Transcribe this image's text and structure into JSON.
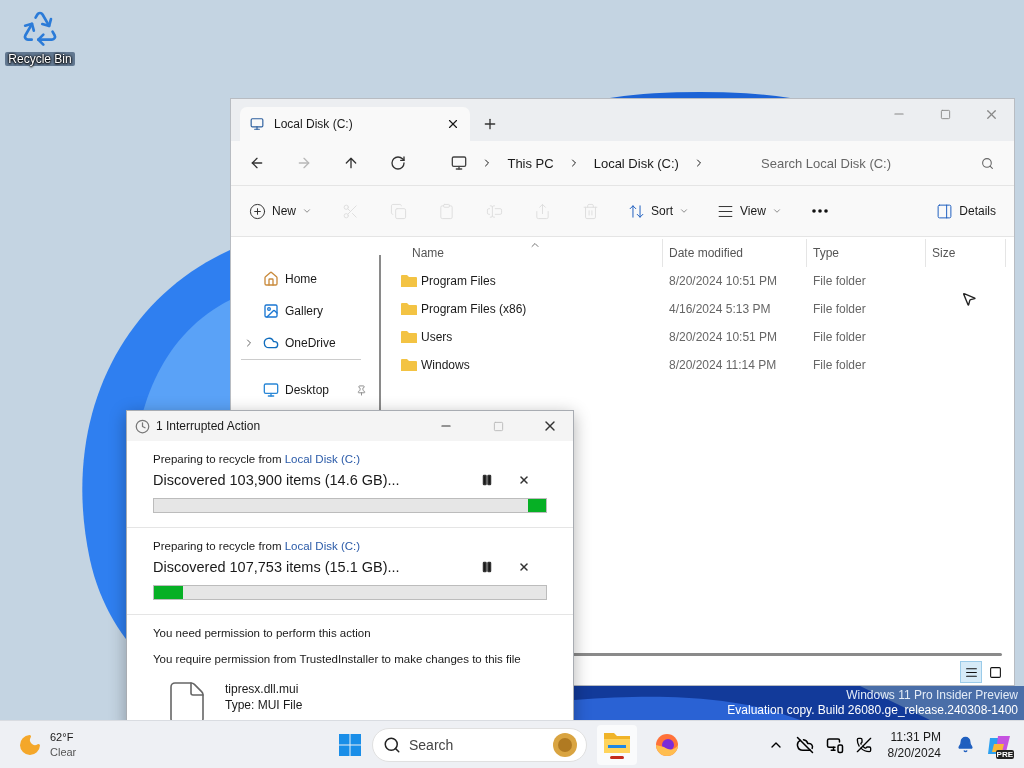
{
  "desktop_icons": [
    {
      "label": "Recycle Bin"
    }
  ],
  "explorer": {
    "tabs": [
      {
        "label": "Local Disk (C:)",
        "selected": true
      }
    ],
    "nav": [
      {
        "kind": "back",
        "disabled": false
      },
      {
        "kind": "forward",
        "disabled": true
      },
      {
        "kind": "up",
        "disabled": false
      },
      {
        "kind": "refresh",
        "disabled": false
      }
    ],
    "breadcrumb": [
      "This PC",
      "Local Disk (C:)"
    ],
    "search": {
      "placeholder": "Search Local Disk (C:)"
    },
    "toolbar": [
      {
        "kind": "new",
        "label": "New",
        "dropdown": true,
        "disabled": false
      },
      {
        "kind": "cut",
        "disabled": true
      },
      {
        "kind": "copy",
        "disabled": true
      },
      {
        "kind": "paste",
        "disabled": true
      },
      {
        "kind": "rename",
        "disabled": true
      },
      {
        "kind": "share",
        "disabled": true
      },
      {
        "kind": "delete",
        "disabled": true
      },
      {
        "kind": "sort",
        "label": "Sort",
        "dropdown": true,
        "disabled": false
      },
      {
        "kind": "view",
        "label": "View",
        "dropdown": true,
        "disabled": false
      },
      {
        "kind": "more",
        "disabled": false
      },
      {
        "kind": "details",
        "label": "Details",
        "dropdown": false,
        "disabled": false
      }
    ],
    "sidebar": {
      "items": [
        {
          "kind": "home",
          "label": "Home",
          "expandable": false,
          "pinned": false
        },
        {
          "kind": "gallery",
          "label": "Gallery",
          "expandable": false,
          "pinned": false
        },
        {
          "kind": "cloud",
          "label": "OneDrive",
          "expandable": true,
          "pinned": false
        },
        {
          "kind": "desktop",
          "label": "Desktop",
          "expandable": false,
          "pinned": true
        }
      ]
    },
    "table": {
      "columns": [
        {
          "label": "Name",
          "sorted": true
        },
        {
          "label": "Date modified",
          "sorted": false
        },
        {
          "label": "Type",
          "sorted": false
        },
        {
          "label": "Size",
          "sorted": false
        }
      ],
      "rows": [
        {
          "name": "Program Files",
          "date": "8/20/2024 10:51 PM",
          "type": "File folder"
        },
        {
          "name": "Program Files (x86)",
          "date": "4/16/2024 5:13 PM",
          "type": "File folder"
        },
        {
          "name": "Users",
          "date": "8/20/2024 10:51 PM",
          "type": "File folder"
        },
        {
          "name": "Windows",
          "date": "8/20/2024 11:14 PM",
          "type": "File folder"
        }
      ]
    },
    "view_toggles": [
      {
        "kind": "details",
        "selected": true
      },
      {
        "kind": "tiles",
        "selected": false
      }
    ]
  },
  "dialog": {
    "title": "1 Interrupted Action",
    "operations": [
      {
        "prefix": "Preparing to recycle from",
        "link": "Local Disk (C:)",
        "status": "Discovered 103,900 items (14.6 GB)...",
        "progress": {
          "kind": "trailing",
          "level": 0.046
        }
      },
      {
        "prefix": "Preparing to recycle from",
        "link": "Local Disk (C:)",
        "status": "Discovered 107,753 items (15.1 GB)...",
        "progress": {
          "kind": "leading",
          "level": 0.075
        }
      }
    ],
    "permission": {
      "heading": "You need permission to perform this action",
      "detail": "You require permission from TrustedInstaller to make changes to this file",
      "file": {
        "name": "tipresx.dll.mui",
        "type": "Type: MUI File"
      }
    }
  },
  "watermark": [
    "Windows 11 Pro Insider Preview",
    "Evaluation copy. Build 26080.ge_release.240308-1400"
  ],
  "taskbar": {
    "weather": {
      "temperature": "62°F",
      "condition": "Clear"
    },
    "search": {
      "placeholder": "Search"
    },
    "apps": [
      {
        "kind": "explorer",
        "running": true
      },
      {
        "kind": "firefox",
        "running": false
      }
    ],
    "clock": {
      "time": "11:31 PM",
      "date": "8/20/2024"
    },
    "copilot_badge": "PRE"
  }
}
